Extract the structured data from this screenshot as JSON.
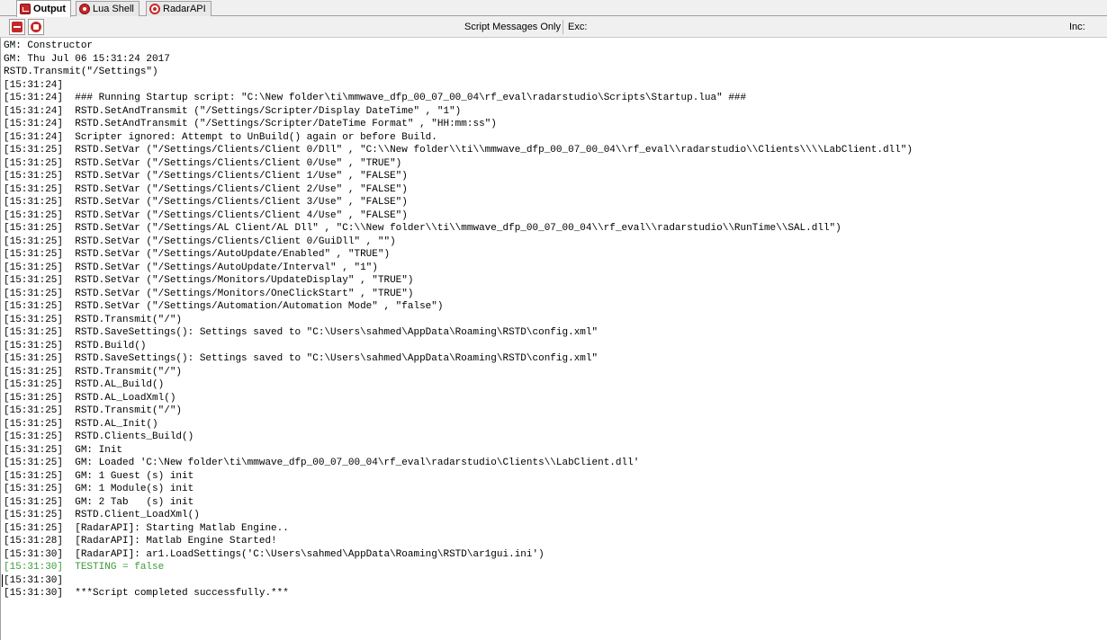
{
  "tabs": [
    {
      "label": "Output",
      "icon": "output-icon",
      "active": true
    },
    {
      "label": "Lua Shell",
      "icon": "lua-shell-icon",
      "active": false
    },
    {
      "label": "RadarAPI",
      "icon": "radar-api-icon",
      "active": false
    }
  ],
  "toolbar": {
    "filter_label": "Script Messages Only",
    "exc_label": "Exc:",
    "exc_value": "",
    "inc_label": "Inc:",
    "inc_value": ""
  },
  "colors": {
    "accent": "#c62828",
    "success_text": "#3a9a3a"
  },
  "output": {
    "lines": [
      {
        "text": "GM: Constructor",
        "color": "default"
      },
      {
        "text": "GM: Thu Jul 06 15:31:24 2017",
        "color": "default"
      },
      {
        "text": "RSTD.Transmit(\"/Settings\")",
        "color": "default"
      },
      {
        "text": "[15:31:24]",
        "color": "default"
      },
      {
        "text": "[15:31:24]  ### Running Startup script: \"C:\\New folder\\ti\\mmwave_dfp_00_07_00_04\\rf_eval\\radarstudio\\Scripts\\Startup.lua\" ###",
        "color": "default"
      },
      {
        "text": "[15:31:24]  RSTD.SetAndTransmit (\"/Settings/Scripter/Display DateTime\" , \"1\")",
        "color": "default"
      },
      {
        "text": "[15:31:24]  RSTD.SetAndTransmit (\"/Settings/Scripter/DateTime Format\" , \"HH:mm:ss\")",
        "color": "default"
      },
      {
        "text": "[15:31:24]  Scripter ignored: Attempt to UnBuild() again or before Build.",
        "color": "default"
      },
      {
        "text": "[15:31:25]  RSTD.SetVar (\"/Settings/Clients/Client 0/Dll\" , \"C:\\\\New folder\\\\ti\\\\mmwave_dfp_00_07_00_04\\\\rf_eval\\\\radarstudio\\\\Clients\\\\\\\\LabClient.dll\")",
        "color": "default"
      },
      {
        "text": "[15:31:25]  RSTD.SetVar (\"/Settings/Clients/Client 0/Use\" , \"TRUE\")",
        "color": "default"
      },
      {
        "text": "[15:31:25]  RSTD.SetVar (\"/Settings/Clients/Client 1/Use\" , \"FALSE\")",
        "color": "default"
      },
      {
        "text": "[15:31:25]  RSTD.SetVar (\"/Settings/Clients/Client 2/Use\" , \"FALSE\")",
        "color": "default"
      },
      {
        "text": "[15:31:25]  RSTD.SetVar (\"/Settings/Clients/Client 3/Use\" , \"FALSE\")",
        "color": "default"
      },
      {
        "text": "[15:31:25]  RSTD.SetVar (\"/Settings/Clients/Client 4/Use\" , \"FALSE\")",
        "color": "default"
      },
      {
        "text": "[15:31:25]  RSTD.SetVar (\"/Settings/AL Client/AL Dll\" , \"C:\\\\New folder\\\\ti\\\\mmwave_dfp_00_07_00_04\\\\rf_eval\\\\radarstudio\\\\RunTime\\\\SAL.dll\")",
        "color": "default"
      },
      {
        "text": "[15:31:25]  RSTD.SetVar (\"/Settings/Clients/Client 0/GuiDll\" , \"\")",
        "color": "default"
      },
      {
        "text": "[15:31:25]  RSTD.SetVar (\"/Settings/AutoUpdate/Enabled\" , \"TRUE\")",
        "color": "default"
      },
      {
        "text": "[15:31:25]  RSTD.SetVar (\"/Settings/AutoUpdate/Interval\" , \"1\")",
        "color": "default"
      },
      {
        "text": "[15:31:25]  RSTD.SetVar (\"/Settings/Monitors/UpdateDisplay\" , \"TRUE\")",
        "color": "default"
      },
      {
        "text": "[15:31:25]  RSTD.SetVar (\"/Settings/Monitors/OneClickStart\" , \"TRUE\")",
        "color": "default"
      },
      {
        "text": "[15:31:25]  RSTD.SetVar (\"/Settings/Automation/Automation Mode\" , \"false\")",
        "color": "default"
      },
      {
        "text": "[15:31:25]  RSTD.Transmit(\"/\")",
        "color": "default"
      },
      {
        "text": "[15:31:25]  RSTD.SaveSettings(): Settings saved to \"C:\\Users\\sahmed\\AppData\\Roaming\\RSTD\\config.xml\"",
        "color": "default"
      },
      {
        "text": "[15:31:25]  RSTD.Build()",
        "color": "default"
      },
      {
        "text": "[15:31:25]  RSTD.SaveSettings(): Settings saved to \"C:\\Users\\sahmed\\AppData\\Roaming\\RSTD\\config.xml\"",
        "color": "default"
      },
      {
        "text": "[15:31:25]  RSTD.Transmit(\"/\")",
        "color": "default"
      },
      {
        "text": "[15:31:25]  RSTD.AL_Build()",
        "color": "default"
      },
      {
        "text": "[15:31:25]  RSTD.AL_LoadXml()",
        "color": "default"
      },
      {
        "text": "[15:31:25]  RSTD.Transmit(\"/\")",
        "color": "default"
      },
      {
        "text": "[15:31:25]  RSTD.AL_Init()",
        "color": "default"
      },
      {
        "text": "[15:31:25]  RSTD.Clients_Build()",
        "color": "default"
      },
      {
        "text": "[15:31:25]  GM: Init",
        "color": "default"
      },
      {
        "text": "[15:31:25]  GM: Loaded 'C:\\New folder\\ti\\mmwave_dfp_00_07_00_04\\rf_eval\\radarstudio\\Clients\\\\LabClient.dll'",
        "color": "default"
      },
      {
        "text": "[15:31:25]  GM: 1 Guest (s) init",
        "color": "default"
      },
      {
        "text": "[15:31:25]  GM: 1 Module(s) init",
        "color": "default"
      },
      {
        "text": "[15:31:25]  GM: 2 Tab   (s) init",
        "color": "default"
      },
      {
        "text": "[15:31:25]  RSTD.Client_LoadXml()",
        "color": "default"
      },
      {
        "text": "[15:31:25]  [RadarAPI]: Starting Matlab Engine..",
        "color": "default"
      },
      {
        "text": "[15:31:28]  [RadarAPI]: Matlab Engine Started!",
        "color": "default"
      },
      {
        "text": "[15:31:30]  [RadarAPI]: ar1.LoadSettings('C:\\Users\\sahmed\\AppData\\Roaming\\RSTD\\ar1gui.ini')",
        "color": "default"
      },
      {
        "text": "[15:31:30]  TESTING = false",
        "color": "green"
      },
      {
        "text": "[15:31:30]",
        "color": "default"
      },
      {
        "text": "[15:31:30]  ***Script completed successfully.***",
        "color": "default"
      }
    ]
  }
}
